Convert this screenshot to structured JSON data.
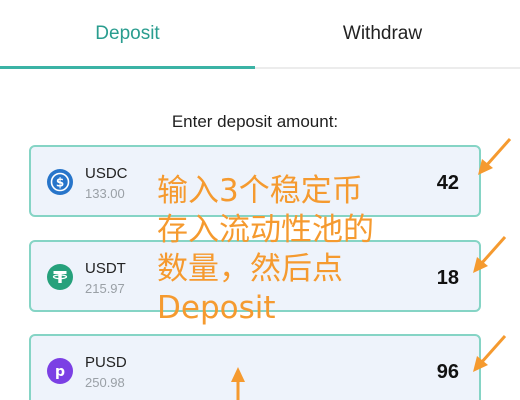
{
  "tabs": [
    {
      "label": "Deposit",
      "active": true
    },
    {
      "label": "Withdraw",
      "active": false
    }
  ],
  "prompt": "Enter deposit amount:",
  "tokens": [
    {
      "name": "USDC",
      "balance": "133.00",
      "amount": "42",
      "icon": "usdc-icon",
      "color": "#2775ca"
    },
    {
      "name": "USDT",
      "balance": "215.97",
      "amount": "18",
      "icon": "usdt-icon",
      "color": "#26a17b"
    },
    {
      "name": "PUSD",
      "balance": "250.98",
      "amount": "96",
      "icon": "pusd-icon",
      "color": "#7b3fe4"
    }
  ],
  "annotation": {
    "lines": [
      "输入3个稳定币",
      "存入流动性池的",
      "数量，然后点",
      "Deposit"
    ],
    "color": "#f59a2f"
  },
  "colors": {
    "accent": "#2a9d8f",
    "card_border": "#85d4c5",
    "card_bg": "#eef3fb"
  }
}
